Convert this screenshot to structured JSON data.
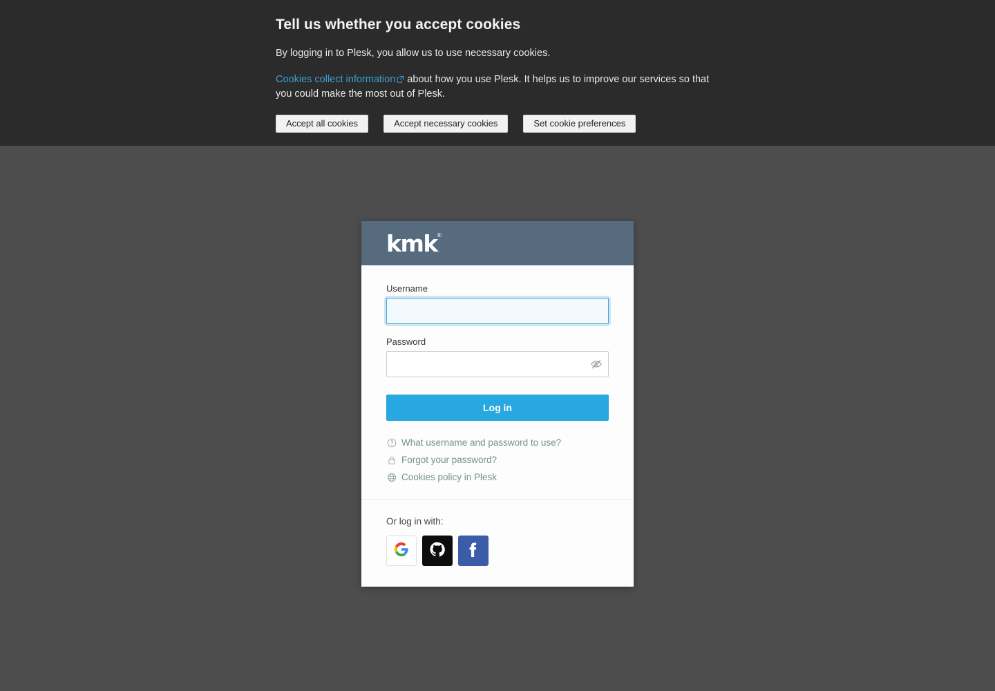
{
  "page": {
    "background_color": "#4d4d4d"
  },
  "cookie_banner": {
    "background_color": "#2b2b2b",
    "title": "Tell us whether you accept cookies",
    "paragraph_1": "By logging in to Plesk, you allow us to use necessary cookies.",
    "link_text": "Cookies collect information",
    "link_icon": "external-link-icon",
    "paragraph_2_rest": " about how you use Plesk. It helps us to improve our services so that you could make the most out of Plesk.",
    "link_color": "#3d9fd6",
    "buttons": [
      {
        "label": "Accept all cookies",
        "name": "accept-all-cookies-button"
      },
      {
        "label": "Accept necessary cookies",
        "name": "accept-necessary-cookies-button"
      },
      {
        "label": "Set cookie preferences",
        "name": "set-cookie-preferences-button"
      }
    ]
  },
  "login_card": {
    "header": {
      "background_color": "#566b7d",
      "logo_text": "kmk",
      "logo_registered_mark": "®"
    },
    "username": {
      "label": "Username",
      "value": "",
      "placeholder": "",
      "focused": true
    },
    "password": {
      "label": "Password",
      "value": "",
      "placeholder": "",
      "toggle_icon": "eye-slash-icon"
    },
    "submit": {
      "label": "Log in",
      "color": "#28a8e0"
    },
    "help_links": [
      {
        "label": "What username and password to use?",
        "icon": "question-circle-icon",
        "name": "what-username-password-link"
      },
      {
        "label": "Forgot your password?",
        "icon": "lock-icon",
        "name": "forgot-password-link"
      },
      {
        "label": "Cookies policy in Plesk",
        "icon": "globe-icon",
        "name": "cookies-policy-link"
      }
    ],
    "help_link_color": "#74918f",
    "footer": {
      "label": "Or log in with:",
      "providers": [
        {
          "name": "google-login-button",
          "icon": "google-icon",
          "background": "#ffffff"
        },
        {
          "name": "github-login-button",
          "icon": "github-icon",
          "background": "#0d0d0d"
        },
        {
          "name": "facebook-login-button",
          "icon": "facebook-icon",
          "background": "#3b5ca9"
        }
      ]
    }
  }
}
